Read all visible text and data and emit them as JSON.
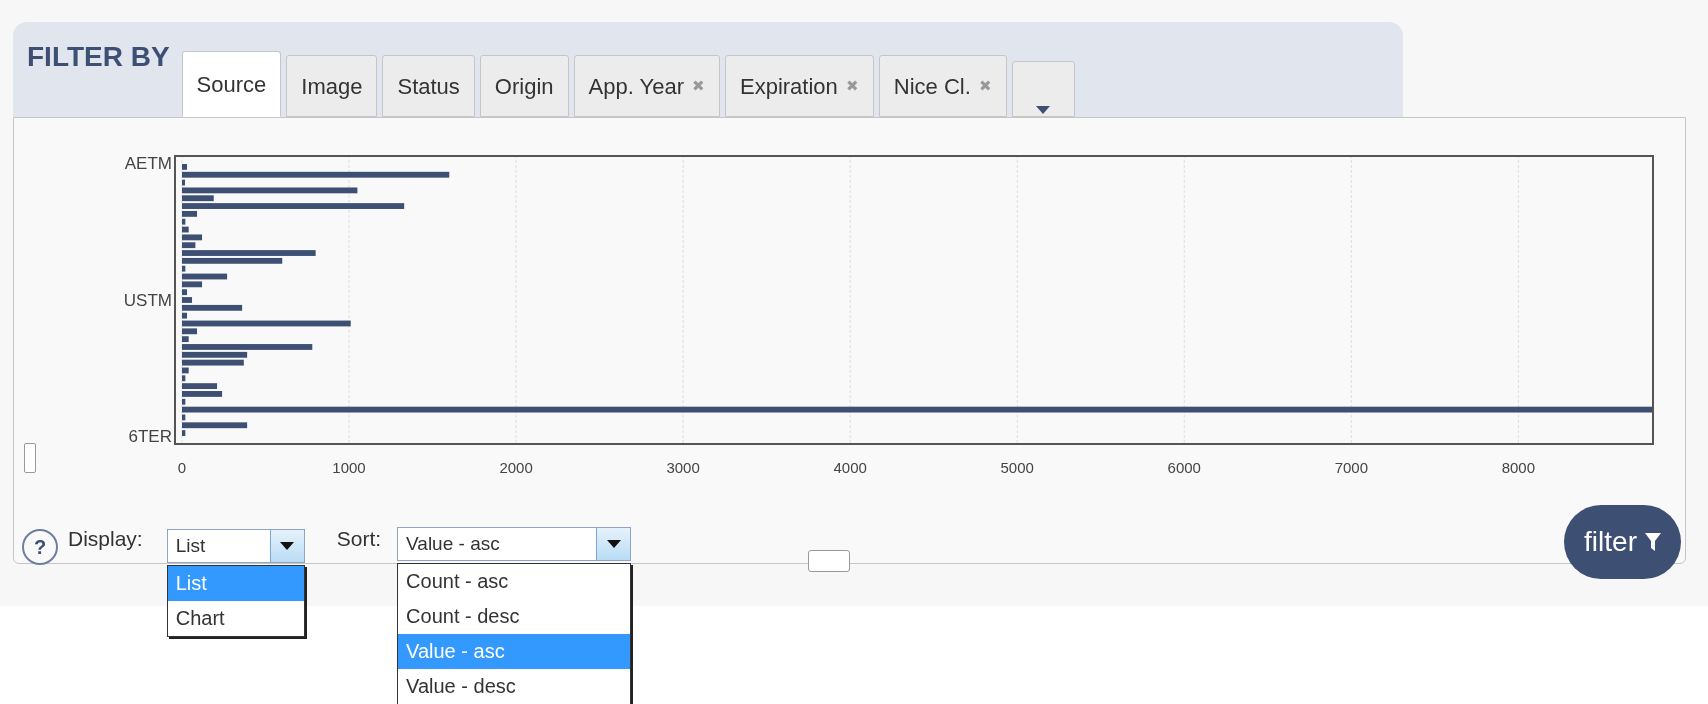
{
  "header": {
    "title": "FILTER BY"
  },
  "tabs": [
    {
      "label": "Source",
      "selected": true,
      "closable": false
    },
    {
      "label": "Image",
      "selected": false,
      "closable": false
    },
    {
      "label": "Status",
      "selected": false,
      "closable": false
    },
    {
      "label": "Origin",
      "selected": false,
      "closable": false
    },
    {
      "label": "App. Year",
      "selected": false,
      "closable": true,
      "close": "✖"
    },
    {
      "label": "Expiration",
      "selected": false,
      "closable": true,
      "close": "✖"
    },
    {
      "label": "Nice Cl.",
      "selected": false,
      "closable": true,
      "close": "✖"
    }
  ],
  "axis_labels": [
    "AETM",
    "USTM",
    "6TER"
  ],
  "chart_data": {
    "type": "bar",
    "orientation": "horizontal",
    "grid": true,
    "xlim": [
      0,
      8800
    ],
    "xticks": [
      0,
      1000,
      2000,
      3000,
      4000,
      5000,
      6000,
      7000,
      8000
    ],
    "series": [
      {
        "color": "#3d4f73",
        "values": [
          30,
          1600,
          10,
          1050,
          190,
          1330,
          90,
          20,
          40,
          120,
          80,
          800,
          600,
          20,
          270,
          120,
          30,
          60,
          360,
          30,
          1010,
          90,
          40,
          780,
          390,
          370,
          40,
          20,
          210,
          240,
          20,
          8800,
          20,
          390,
          20
        ]
      }
    ]
  },
  "controls": {
    "help": "?",
    "display": {
      "label": "Display:",
      "value": "List",
      "options": [
        {
          "label": "List",
          "selected": true
        },
        {
          "label": "Chart",
          "selected": false
        }
      ]
    },
    "sort": {
      "label": "Sort:",
      "value": "Value - asc",
      "options": [
        {
          "label": "Count - asc",
          "selected": false
        },
        {
          "label": "Count - desc",
          "selected": false
        },
        {
          "label": "Value - asc",
          "selected": true
        },
        {
          "label": "Value - desc",
          "selected": false
        }
      ]
    },
    "filter_button": "filter"
  }
}
